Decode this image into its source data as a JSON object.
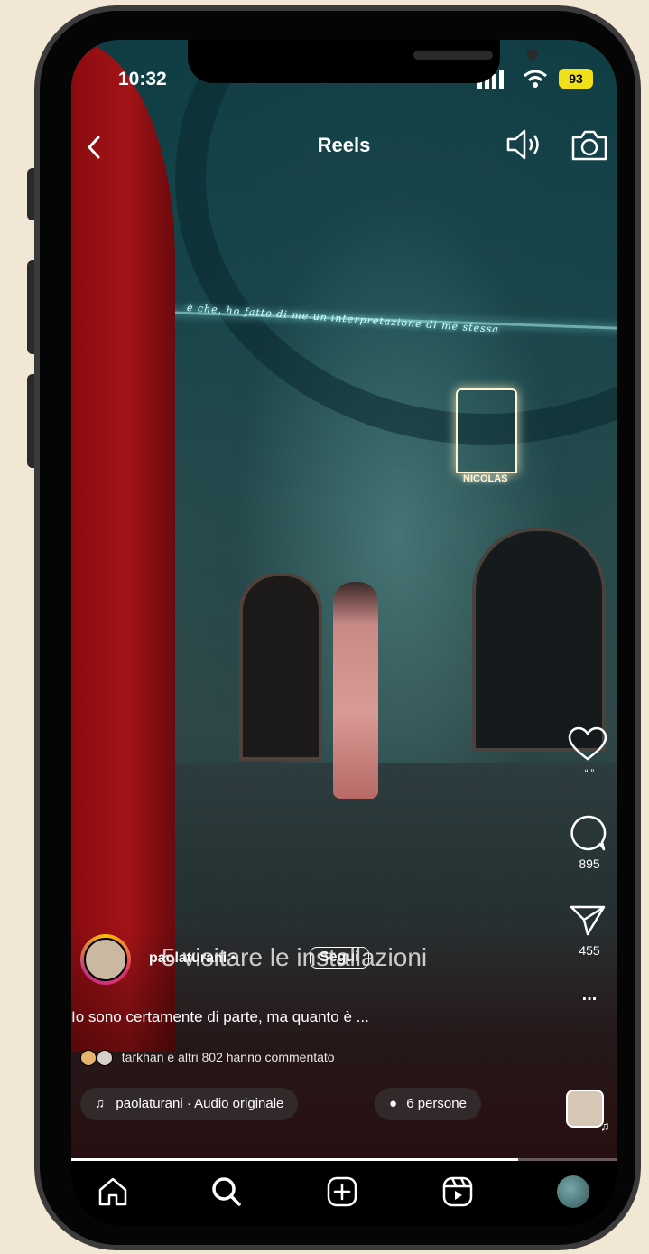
{
  "status_bar": {
    "time": "10:32",
    "battery": "93"
  },
  "header": {
    "title": "Reels",
    "back_icon": "chevron-left-icon",
    "sound_icon": "speaker-icon",
    "camera_icon": "camera-icon"
  },
  "scene_text": {
    "neon_line": "è che, ho fatto di me un'interpretazione di me stessa",
    "neon_sign": "NICOLAS"
  },
  "actions": {
    "likes": "“ ”",
    "comments": "895",
    "shares": "455",
    "more": "..."
  },
  "post": {
    "username": "paolaturani •",
    "follow_label": "Segui",
    "overlay_text": "5 visitare le installazioni",
    "caption": "Io sono certamente di parte, ma quanto è ...",
    "comments_summary": "tarkhan e altri 802 hanno commentato",
    "audio_label": "paolaturani · Audio originale",
    "people_label": "6 persone"
  },
  "progress": {
    "fraction": 0.82
  },
  "nav": {
    "items": [
      "home-icon",
      "search-icon",
      "create-icon",
      "reels-icon",
      "profile-avatar"
    ]
  },
  "colors": {
    "accent_battery": "#f0e018",
    "pillar": "#a31317"
  }
}
